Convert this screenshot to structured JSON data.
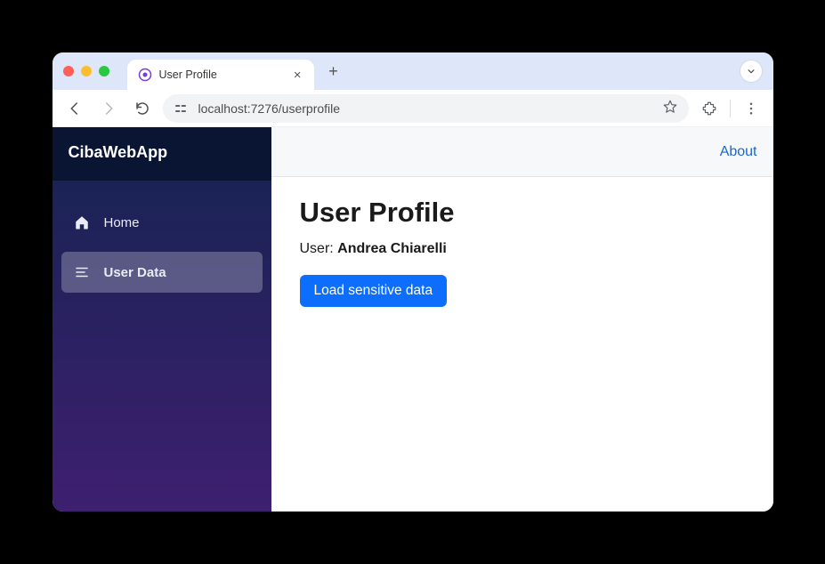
{
  "browser": {
    "tab_title": "User Profile",
    "url": "localhost:7276/userprofile"
  },
  "sidebar": {
    "brand": "CibaWebApp",
    "items": [
      {
        "label": "Home",
        "icon": "home-icon",
        "active": false
      },
      {
        "label": "User Data",
        "icon": "list-icon",
        "active": true
      }
    ]
  },
  "topbar": {
    "about_label": "About"
  },
  "page": {
    "heading": "User Profile",
    "user_prefix": "User: ",
    "user_name": "Andrea Chiarelli",
    "load_button": "Load sensitive data"
  }
}
